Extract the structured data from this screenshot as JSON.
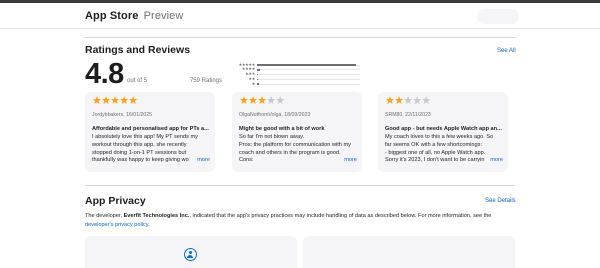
{
  "header": {
    "brand": "App Store",
    "subtitle": "Preview"
  },
  "ratings": {
    "title": "Ratings and Reviews",
    "see_all": "See All",
    "score": "4.8",
    "out_of": "out of 5",
    "count": "759 Ratings",
    "histogram": [
      {
        "stars": "★★★★★",
        "fraction": 0.96
      },
      {
        "stars": "★★★★",
        "fraction": 0.03
      },
      {
        "stars": "★★★",
        "fraction": 0.01
      },
      {
        "stars": "★★",
        "fraction": 0.01
      },
      {
        "stars": "★",
        "fraction": 0.02
      }
    ]
  },
  "reviews": [
    {
      "rating": 5,
      "author": "Jordybbakers, 16/01/2025",
      "title": "Affordable and personalised app for PTs a...",
      "body": "I absolutely love this app! My PT sends my\nworkout through this app, she recently\nstopped doing 1-on-1 PT sessions but\nthankfully was happy to keep giving wo",
      "more": "more"
    },
    {
      "rating": 3,
      "author": "OlgaNotfromVolga, 18/09/2023",
      "title": "Might be good with a bit of work",
      "body": "So far I'm not blown away.\nPros: the platform for communication with my\ncoach and others in the program is good.\nCons:",
      "more": "more"
    },
    {
      "rating": 2,
      "author": "SRM80, 22/11/2023",
      "title": "Good app - but needs Apple Watch app an...",
      "body": "My coach loves to this a few weeks ago. So\nfar seems OK with a few shortcomings:\n- biggest one of all, no Apple Watch app.\nSorry it's 2023, I don't want to be carryin",
      "more": "more"
    }
  ],
  "privacy": {
    "title": "App Privacy",
    "see_details": "See Details",
    "text_prefix": "The developer, ",
    "developer": "Everfit Technologies Inc.",
    "text_middle": ", indicated that the app's privacy practices may include handling of data as described below. For more information, see the ",
    "policy_link": "developer's privacy policy",
    "text_suffix": "."
  },
  "colors": {
    "accent": "#0066cc",
    "star": "#ff9f0a",
    "card": "#f5f5f7"
  }
}
